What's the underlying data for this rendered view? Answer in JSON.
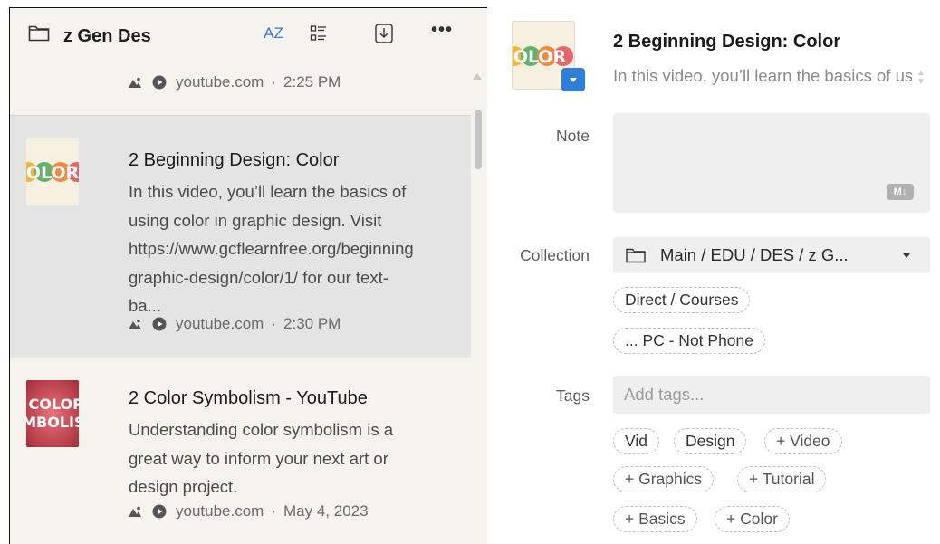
{
  "header": {
    "collection_title": "z Gen Des",
    "sort_label": "AZ",
    "more_label": "•••"
  },
  "list": {
    "items": [
      {
        "title": "",
        "desc": "",
        "domain": "youtube.com",
        "time": "2:25 PM"
      },
      {
        "title": "2 Beginning Design: Color",
        "desc": "In this video, you’ll learn the basics of\nusing color in graphic design. Visit\nhttps://www.gcflearnfree.org/beginning\ngraphic-design/color/1/ for our text-\nba...",
        "domain": "youtube.com",
        "time": "2:30 PM",
        "thumb_text": "OLOR"
      },
      {
        "title": "2 Color Symbolism - YouTube",
        "desc": "Understanding color symbolism is a\ngreat way to inform your next art or\ndesign project.",
        "domain": "youtube.com",
        "time": "May 4, 2023",
        "thumb_text_1": "COLOR",
        "thumb_text_2": "YMBOLIS"
      }
    ],
    "separator": "·"
  },
  "detail": {
    "title": "2 Beginning Design: Color",
    "desc": "In this video, you’ll learn the basics of using color in graphic design.",
    "thumb_text": "OLOR",
    "note_label": "Note",
    "note_value": "",
    "md_badge": "M↓",
    "collection_label": "Collection",
    "collection_value": "Main / EDU / DES / z G...",
    "collection_chips": [
      "Direct / Courses",
      "... PC - Not Phone"
    ],
    "tags_label": "Tags",
    "tags_placeholder": "Add tags...",
    "tags": [
      "Vid",
      "Design"
    ],
    "suggested_tags": [
      "+ Video",
      "+ Graphics",
      "+ Tutorial",
      "+ Basics",
      "+ Color"
    ]
  },
  "colors": {
    "accent": "#3b7ad8",
    "list_bg": "#f4f3ee",
    "selected_bg": "#e4e4e4"
  }
}
